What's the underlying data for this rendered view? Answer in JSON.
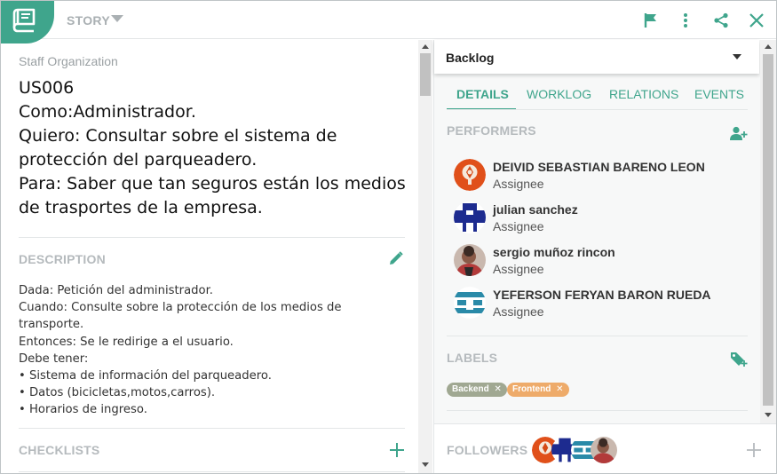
{
  "header": {
    "type_label": "STORY"
  },
  "story": {
    "project": "Staff Organization",
    "title_lines": [
      "US006",
      "Como:Administrador.",
      "Quiero: Consultar sobre el sistema de",
      "protección del parqueadero.",
      "Para: Saber que tan seguros están  los medios",
      "de trasportes de la empresa."
    ]
  },
  "description": {
    "heading": "DESCRIPTION",
    "lines": [
      "Dada: Petición del administrador.",
      "Cuando: Consulte sobre la protección de los medios de",
      "transporte.",
      "Entonces: Se le redirige a el usuario.",
      "Debe tener:",
      "• Sistema de información del parqueadero.",
      "• Datos (bicicletas,motos,carros).",
      "• Horarios de ingreso."
    ]
  },
  "checklists": {
    "heading": "CHECKLISTS"
  },
  "status": {
    "value": "Backlog"
  },
  "tabs": [
    "DETAILS",
    "WORKLOG",
    "RELATIONS",
    "EVENTS"
  ],
  "performers": {
    "heading": "PERFORMERS",
    "items": [
      {
        "name": "DEIVID SEBASTIAN BARENO LEON",
        "role": "Assignee"
      },
      {
        "name": "julian sanchez",
        "role": "Assignee"
      },
      {
        "name": "sergio muñoz rincon",
        "role": "Assignee"
      },
      {
        "name": "YEFERSON FERYAN BARON RUEDA",
        "role": "Assignee"
      }
    ]
  },
  "labels": {
    "heading": "LABELS",
    "items": [
      {
        "text": "Backend",
        "remove": "✕",
        "color": "#a0a892"
      },
      {
        "text": "Frontend",
        "remove": "✕",
        "color": "#eeab6a"
      }
    ]
  },
  "followers": {
    "heading": "FOLLOWERS"
  },
  "colors": {
    "accent": "#3fa58c",
    "muted": "#b5babd"
  }
}
